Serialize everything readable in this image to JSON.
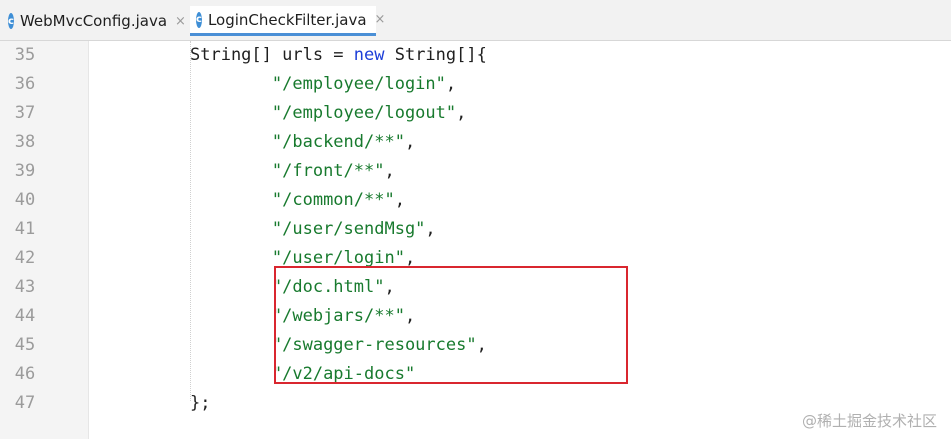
{
  "tabs": [
    {
      "label": "WebMvcConfig.java",
      "icon": "c",
      "close": "×"
    },
    {
      "label": "LoginCheckFilter.java",
      "icon": "c",
      "close": "×",
      "active": true
    }
  ],
  "code": {
    "lines": [
      {
        "num": "35",
        "pre": "String[] urls = ",
        "kw": "new",
        "post": " String[]{",
        "str": "",
        "tail": ""
      },
      {
        "num": "36",
        "pre": "        ",
        "kw": "",
        "post": "",
        "str": "\"/employee/login\"",
        "tail": ","
      },
      {
        "num": "37",
        "pre": "        ",
        "kw": "",
        "post": "",
        "str": "\"/employee/logout\"",
        "tail": ","
      },
      {
        "num": "38",
        "pre": "        ",
        "kw": "",
        "post": "",
        "str": "\"/backend/**\"",
        "tail": ","
      },
      {
        "num": "39",
        "pre": "        ",
        "kw": "",
        "post": "",
        "str": "\"/front/**\"",
        "tail": ","
      },
      {
        "num": "40",
        "pre": "        ",
        "kw": "",
        "post": "",
        "str": "\"/common/**\"",
        "tail": ","
      },
      {
        "num": "41",
        "pre": "        ",
        "kw": "",
        "post": "",
        "str": "\"/user/sendMsg\"",
        "tail": ","
      },
      {
        "num": "42",
        "pre": "        ",
        "kw": "",
        "post": "",
        "str": "\"/user/login\"",
        "tail": ","
      },
      {
        "num": "43",
        "pre": "        ",
        "kw": "",
        "post": "",
        "str": "\"/doc.html\"",
        "tail": ","
      },
      {
        "num": "44",
        "pre": "        ",
        "kw": "",
        "post": "",
        "str": "\"/webjars/**\"",
        "tail": ","
      },
      {
        "num": "45",
        "pre": "        ",
        "kw": "",
        "post": "",
        "str": "\"/swagger-resources\"",
        "tail": ","
      },
      {
        "num": "46",
        "pre": "        ",
        "kw": "",
        "post": "",
        "str": "\"/v2/api-docs\"",
        "tail": ""
      },
      {
        "num": "47",
        "pre": "};",
        "kw": "",
        "post": "",
        "str": "",
        "tail": ""
      }
    ]
  },
  "watermark": "@稀土掘金技术社区",
  "colors": {
    "keyword": "#1d3fd8",
    "string": "#187a2e",
    "highlight_box": "#d9262f",
    "active_tab_underline": "#4a8fd6"
  }
}
